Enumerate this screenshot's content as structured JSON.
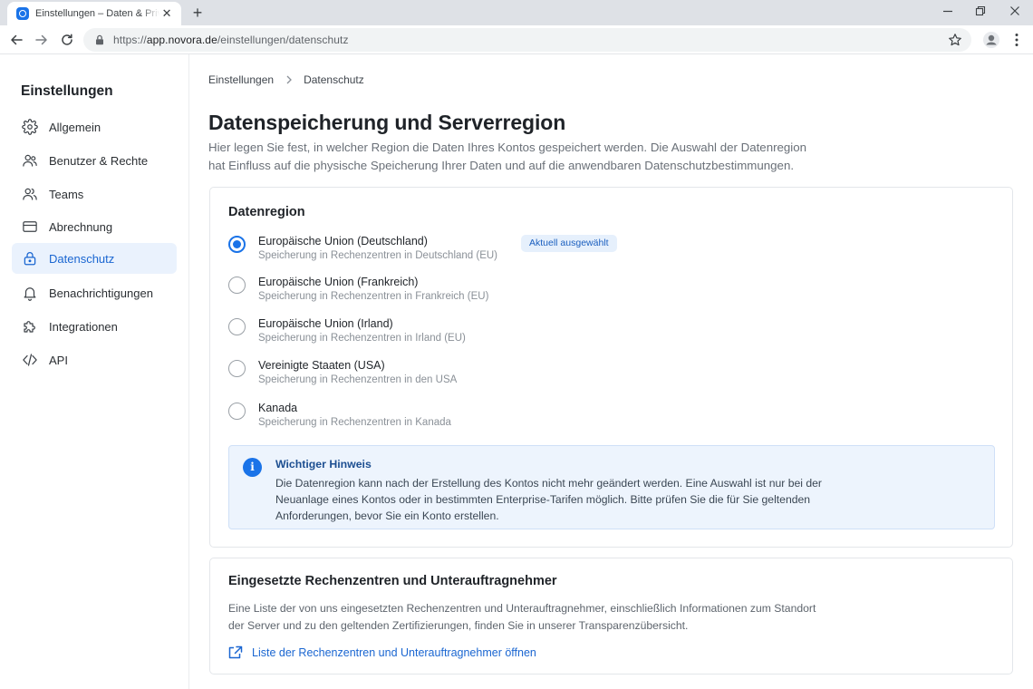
{
  "browser": {
    "tab_title": "Einstellungen – Daten & Privatsphäre",
    "url_protocol": "https://",
    "url_host": "app.novora.de",
    "url_path": "/einstellungen/datenschutz"
  },
  "sidebar": {
    "title": "Einstellungen",
    "items": [
      {
        "label": "Allgemein",
        "icon": "gear-icon"
      },
      {
        "label": "Benutzer & Rechte",
        "icon": "users-icon"
      },
      {
        "label": "Teams",
        "icon": "team-icon"
      },
      {
        "label": "Abrechnung",
        "icon": "credit-card-icon"
      },
      {
        "label": "Datenschutz",
        "icon": "lock-icon",
        "active": true
      },
      {
        "label": "Benachrichtigungen",
        "icon": "bell-icon"
      },
      {
        "label": "Integrationen",
        "icon": "puzzle-icon"
      },
      {
        "label": "API",
        "icon": "code-icon"
      }
    ]
  },
  "breadcrumb": {
    "parent": "Einstellungen",
    "current": "Datenschutz"
  },
  "page": {
    "title": "Datenspeicherung und Serverregion",
    "description": "Hier legen Sie fest, in welcher Region die Daten Ihres Kontos gespeichert werden. Die Auswahl der Datenregion hat Einfluss auf die physische Speicherung Ihrer Daten und auf die anwendbaren Datenschutzbestimmungen."
  },
  "region": {
    "title": "Datenregion",
    "selected_badge": "Aktuell ausgewählt",
    "options": [
      {
        "label": "Europäische Union (Deutschland)",
        "sub": "Speicherung in Rechenzentren in Deutschland (EU)",
        "selected": true
      },
      {
        "label": "Europäische Union (Frankreich)",
        "sub": "Speicherung in Rechenzentren in Frankreich (EU)",
        "selected": false
      },
      {
        "label": "Europäische Union (Irland)",
        "sub": "Speicherung in Rechenzentren in Irland (EU)",
        "selected": false
      },
      {
        "label": "Vereinigte Staaten (USA)",
        "sub": "Speicherung in Rechenzentren in den USA",
        "selected": false
      },
      {
        "label": "Kanada",
        "sub": "Speicherung in Rechenzentren in Kanada",
        "selected": false
      }
    ],
    "notice": {
      "title": "Wichtiger Hinweis",
      "text": "Die Datenregion kann nach der Erstellung des Kontos nicht mehr geändert werden. Eine Auswahl ist nur bei der Neuanlage eines Kontos oder in bestimmten Enterprise-Tarifen möglich. Bitte prüfen Sie die für Sie geltenden Anforderungen, bevor Sie ein Konto erstellen."
    }
  },
  "datacenters": {
    "title": "Eingesetzte Rechenzentren und Unterauftragnehmer",
    "text": "Eine Liste der von uns eingesetzten Rechenzentren und Unterauftragnehmer, einschließlich Informationen zum Standort der Server und zu den geltenden Zertifizierungen, finden Sie in unserer Transparenzübersicht.",
    "link_label": "Liste der Rechenzentren und Unterauftragnehmer öffnen"
  },
  "colors": {
    "accent": "#1a73e8",
    "active_nav_bg": "#eaf2fd",
    "notice_bg": "#edf4fd"
  }
}
